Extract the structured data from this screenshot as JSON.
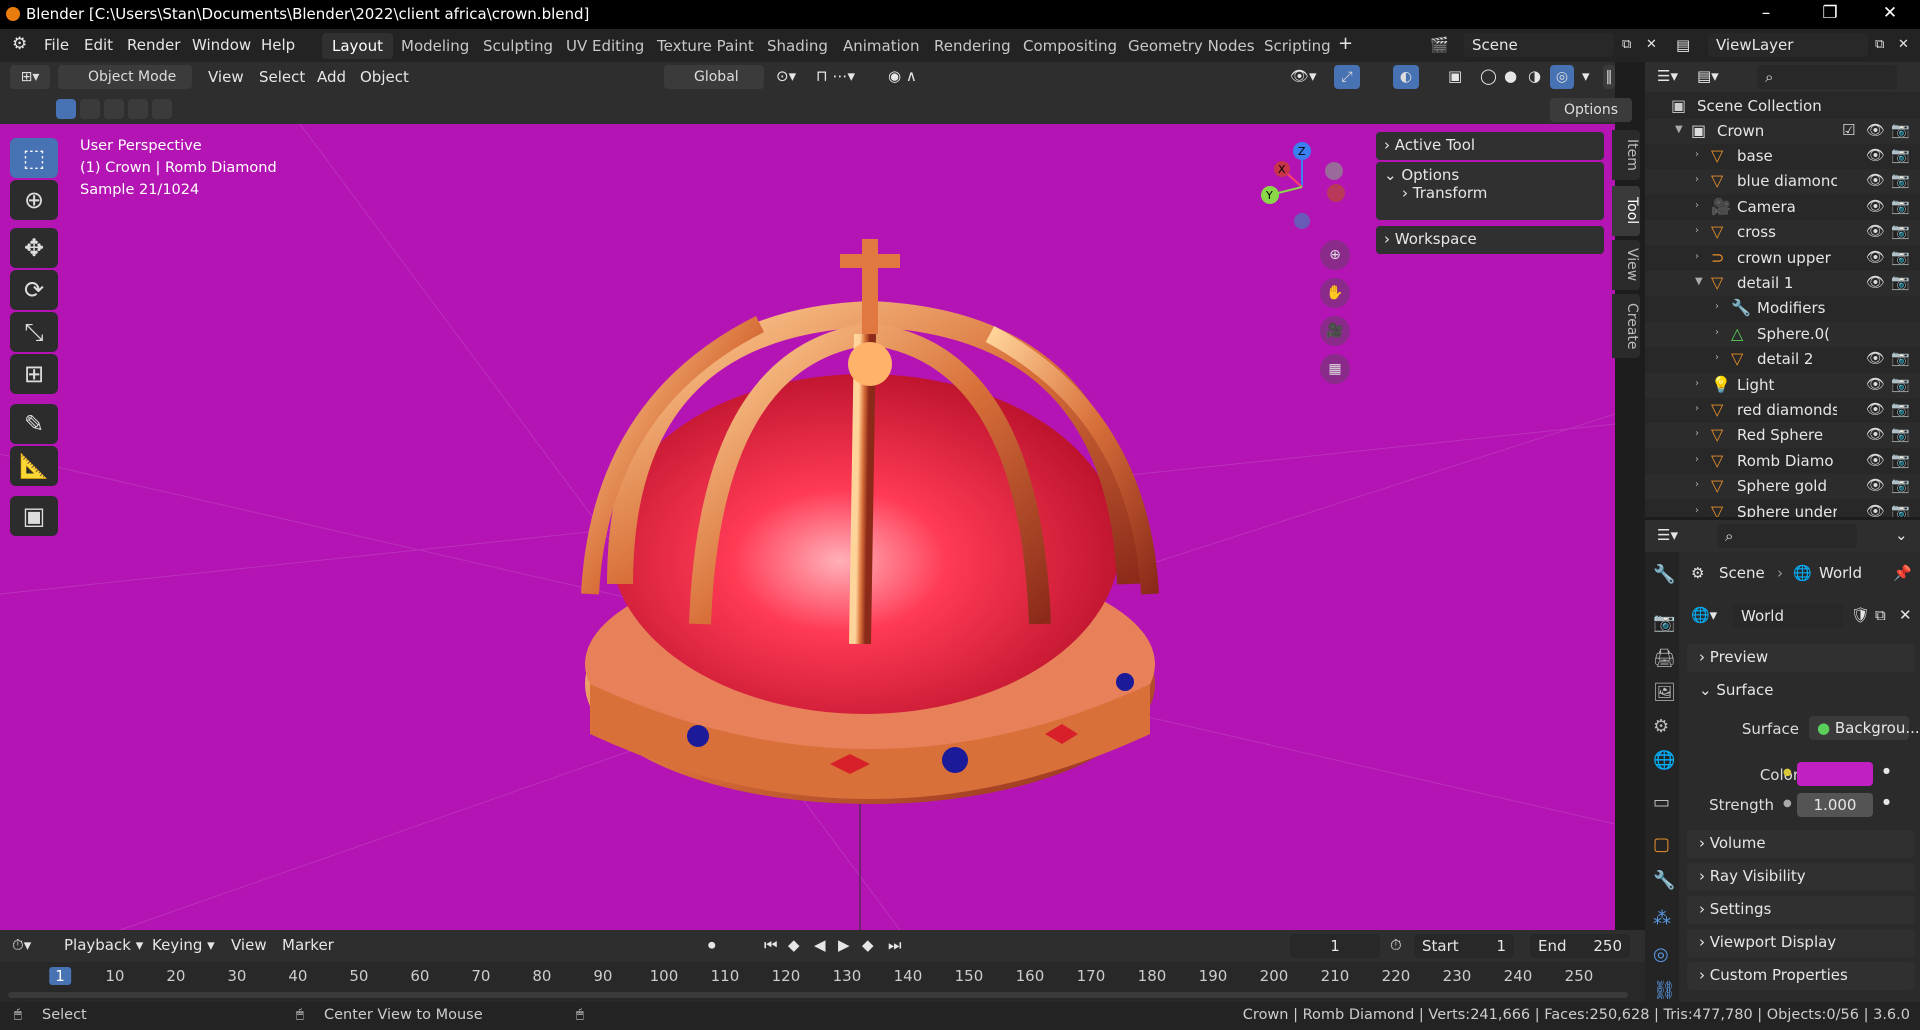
{
  "window": {
    "title": "Blender [C:\\Users\\Stan\\Documents\\Blender\\2022\\client africa\\crown.blend]"
  },
  "menu": {
    "file": "File",
    "edit": "Edit",
    "render": "Render",
    "window": "Window",
    "help": "Help"
  },
  "workspaces": [
    "Layout",
    "Modeling",
    "Sculpting",
    "UV Editing",
    "Texture Paint",
    "Shading",
    "Animation",
    "Rendering",
    "Compositing",
    "Geometry Nodes",
    "Scripting"
  ],
  "scene": {
    "label": "Scene",
    "viewlayer": "ViewLayer"
  },
  "viewport_header": {
    "mode": "Object Mode",
    "view": "View",
    "select": "Select",
    "add": "Add",
    "object": "Object",
    "transform": "Global",
    "options": "Options"
  },
  "viewport": {
    "perspective": "User Perspective",
    "object_info": "(1) Crown | Romb Diamond",
    "sample": "Sample 21/1024",
    "background_color": "#b314b3"
  },
  "npanel": {
    "active_tool": "Active Tool",
    "options": "Options",
    "transform": "Transform",
    "workspace": "Workspace"
  },
  "sidetabs": {
    "item": "Item",
    "tool": "Tool",
    "view": "View",
    "create": "Create"
  },
  "outliner": {
    "scene_collection": "Scene Collection",
    "collection": "Crown",
    "items": [
      {
        "name": "base",
        "icon": "mesh-icon"
      },
      {
        "name": "blue diamonc",
        "icon": "mesh-icon"
      },
      {
        "name": "Camera",
        "icon": "camera-icon"
      },
      {
        "name": "cross",
        "icon": "mesh-icon"
      },
      {
        "name": "crown upper",
        "icon": "curve-icon"
      },
      {
        "name": "detail 1",
        "icon": "mesh-icon"
      },
      {
        "name": "Modifiers",
        "icon": "wrench-icon"
      },
      {
        "name": "Sphere.0(",
        "icon": "mesh-data-icon"
      },
      {
        "name": "detail 2",
        "icon": "mesh-icon"
      },
      {
        "name": "Light",
        "icon": "light-icon"
      },
      {
        "name": "red diamonds",
        "icon": "mesh-icon"
      },
      {
        "name": "Red Sphere",
        "icon": "mesh-icon"
      },
      {
        "name": "Romb Diamo",
        "icon": "mesh-icon"
      },
      {
        "name": "Sphere gold",
        "icon": "mesh-icon"
      },
      {
        "name": "Sphere under",
        "icon": "mesh-icon"
      }
    ]
  },
  "properties": {
    "breadcrumb_scene": "Scene",
    "breadcrumb_world": "World",
    "world_name": "World",
    "sections": {
      "preview": "Preview",
      "surface": "Surface",
      "volume": "Volume",
      "ray_visibility": "Ray Visibility",
      "settings": "Settings",
      "viewport_display": "Viewport Display",
      "custom_properties": "Custom Properties"
    },
    "surface_label": "Surface",
    "surface_value": "Backgrou...",
    "color_label": "Color",
    "color_value": "#c21fc2",
    "strength_label": "Strength",
    "strength_value": "1.000"
  },
  "timeline": {
    "playback": "Playback",
    "keying": "Keying",
    "view": "View",
    "marker": "Marker",
    "current_frame": "1",
    "start_label": "Start",
    "start": "1",
    "end_label": "End",
    "end": "250",
    "ticks": [
      "1",
      "10",
      "20",
      "30",
      "40",
      "50",
      "60",
      "70",
      "80",
      "90",
      "100",
      "110",
      "120",
      "130",
      "140",
      "150",
      "160",
      "170",
      "180",
      "190",
      "200",
      "210",
      "220",
      "230",
      "240",
      "250"
    ]
  },
  "status": {
    "select": "Select",
    "center_view": "Center View to Mouse",
    "stats": "Crown | Romb Diamond | Verts:241,666 | Faces:250,628 | Tris:477,780 | Objects:0/56 | 3.6.0"
  }
}
